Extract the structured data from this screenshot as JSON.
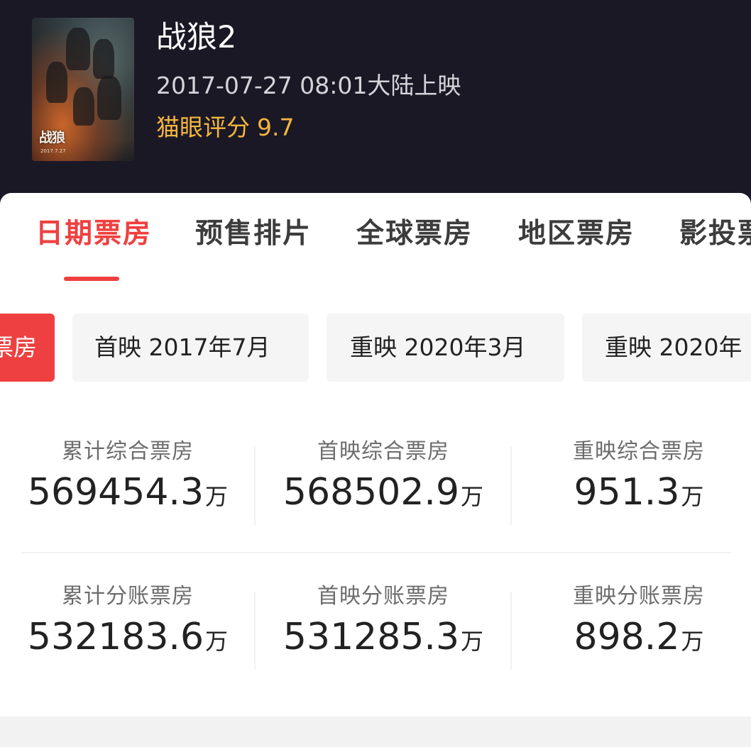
{
  "movie": {
    "title": "战狼2",
    "release": "2017-07-27 08:01大陆上映",
    "rating_label": "猫眼评分",
    "rating_value": "9.7",
    "poster_text": "战狼",
    "poster_date": "2017.7.27"
  },
  "colors": {
    "accent": "#ef3f3f",
    "rating": "#f5b640",
    "header_bg": "#1a1824"
  },
  "tabs": [
    {
      "label": "日期票房",
      "active": true
    },
    {
      "label": "预售排片",
      "active": false
    },
    {
      "label": "全球票房",
      "active": false
    },
    {
      "label": "地区票房",
      "active": false
    },
    {
      "label": "影投票",
      "active": false
    }
  ],
  "chips": [
    {
      "label": "票房",
      "active": true
    },
    {
      "label": "首映 2017年7月",
      "active": false
    },
    {
      "label": "重映 2020年3月",
      "active": false
    },
    {
      "label": "重映 2020年",
      "active": false
    }
  ],
  "stats": {
    "unit": "万",
    "row1": [
      {
        "label": "累计综合票房",
        "value": "569454.3"
      },
      {
        "label": "首映综合票房",
        "value": "568502.9"
      },
      {
        "label": "重映综合票房",
        "value": "951.3"
      }
    ],
    "row2": [
      {
        "label": "累计分账票房",
        "value": "532183.6"
      },
      {
        "label": "首映分账票房",
        "value": "531285.3"
      },
      {
        "label": "重映分账票房",
        "value": "898.2"
      }
    ]
  }
}
